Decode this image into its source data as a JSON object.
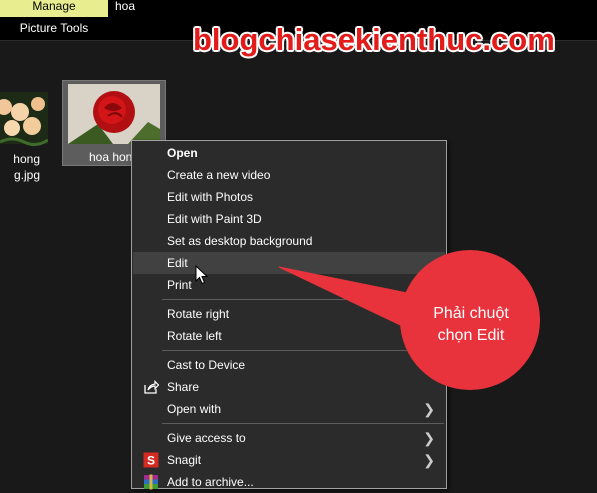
{
  "ribbon": {
    "manage_tab": "Manage",
    "context_group": "Picture Tools",
    "window_title": "hoa"
  },
  "watermark": "blogchiasekienthuc.com",
  "files": [
    {
      "name_line1": "hong",
      "name_line2": "g.jpg"
    },
    {
      "name": "hoa hong"
    }
  ],
  "context_menu": {
    "items": [
      {
        "label": "Open",
        "bold": true
      },
      {
        "label": "Create a new video"
      },
      {
        "label": "Edit with Photos"
      },
      {
        "label": "Edit with Paint 3D"
      },
      {
        "label": "Set as desktop background"
      },
      {
        "label": "Edit",
        "highlighted": true
      },
      {
        "label": "Print"
      },
      {
        "label": "Rotate right"
      },
      {
        "label": "Rotate left"
      },
      {
        "label": "Cast to Device"
      },
      {
        "label": "Share",
        "icon": "share-icon"
      },
      {
        "label": "Open with",
        "submenu": true
      },
      {
        "label": "Give access to",
        "submenu": true
      },
      {
        "label": "Snagit",
        "icon": "snagit-icon",
        "submenu": true
      },
      {
        "label": "Add to archive...",
        "icon": "winrar-icon"
      }
    ]
  },
  "callout": {
    "line1": "Phải chuột",
    "line2": "chọn Edit",
    "color": "#e8323c"
  }
}
